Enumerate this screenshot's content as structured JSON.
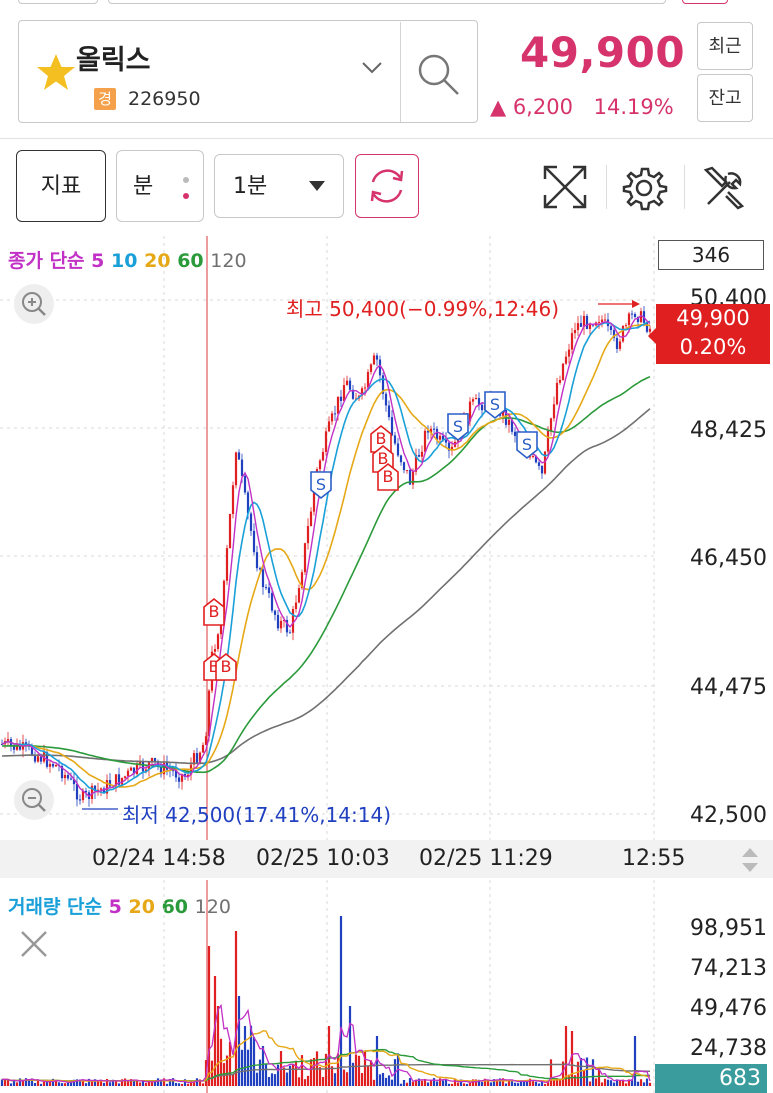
{
  "stock": {
    "name": "올릭스",
    "market_badge": "경",
    "code": "226950",
    "price": "49,900",
    "change": "▲ 6,200",
    "change_pct": "14.19%"
  },
  "side_buttons": {
    "recent": "최근",
    "balance": "잔고"
  },
  "toolbar": {
    "indicator": "지표",
    "period_type": "분",
    "interval": "1분"
  },
  "price_chart": {
    "indicator": {
      "prefix": "종가 단순",
      "ma5": "5",
      "ma10": "10",
      "ma20": "20",
      "ma60": "60",
      "ma120": "120"
    },
    "colors": {
      "ma5": "#c231c6",
      "ma10": "#1aa0d8",
      "ma20": "#e6a817",
      "ma60": "#2a9a3a",
      "ma120": "#707070",
      "up": "#e02020",
      "down": "#2040c0"
    },
    "count_box": "346",
    "high_label": "최고 50,400(−0.99%,12:46)",
    "low_label": "최저 42,500(17.41%,14:14)",
    "current_price_tag": "49,900",
    "current_pct_tag": "0.20%",
    "y_ticks": [
      "50,400",
      "48,425",
      "46,450",
      "44,475",
      "42,500"
    ],
    "x_ticks": [
      "02/24 14:58",
      "02/25 10:03",
      "02/25 11:29",
      "12:55"
    ]
  },
  "volume_chart": {
    "indicator": {
      "prefix": "거래량 단순",
      "ma5": "5",
      "ma20": "20",
      "ma60": "60",
      "ma120": "120"
    },
    "y_ticks": [
      "98,951",
      "74,213",
      "49,476",
      "24,738"
    ],
    "current_tag": "683"
  },
  "signals": {
    "buy": "B",
    "sell": "S"
  }
}
